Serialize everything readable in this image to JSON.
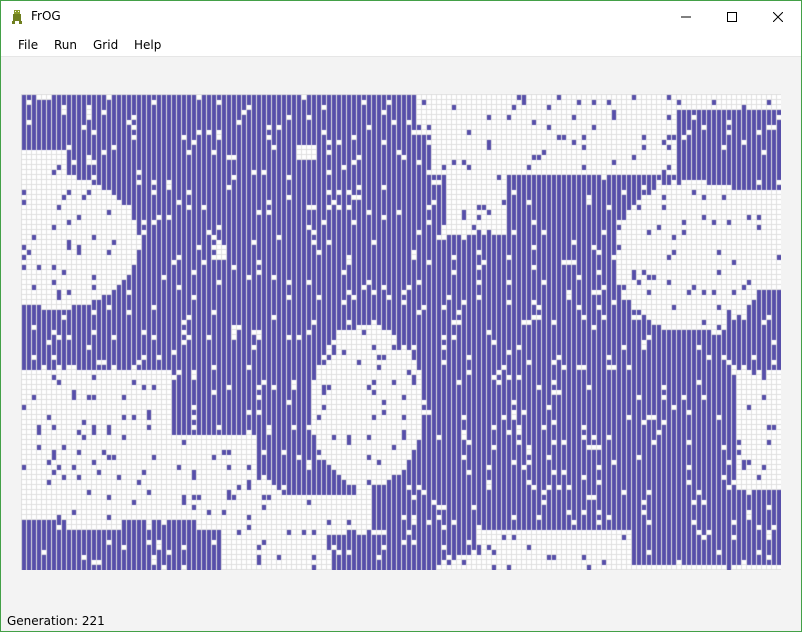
{
  "window": {
    "title": "FrOG"
  },
  "menu": {
    "items": [
      "File",
      "Run",
      "Grid",
      "Help"
    ]
  },
  "grid": {
    "cols": 152,
    "rows": 95,
    "colors": {
      "alive": "#574fa9",
      "dead": "#ffffff",
      "line": "#e0e0e0"
    }
  },
  "status": {
    "label": "Generation:",
    "value": "221"
  }
}
